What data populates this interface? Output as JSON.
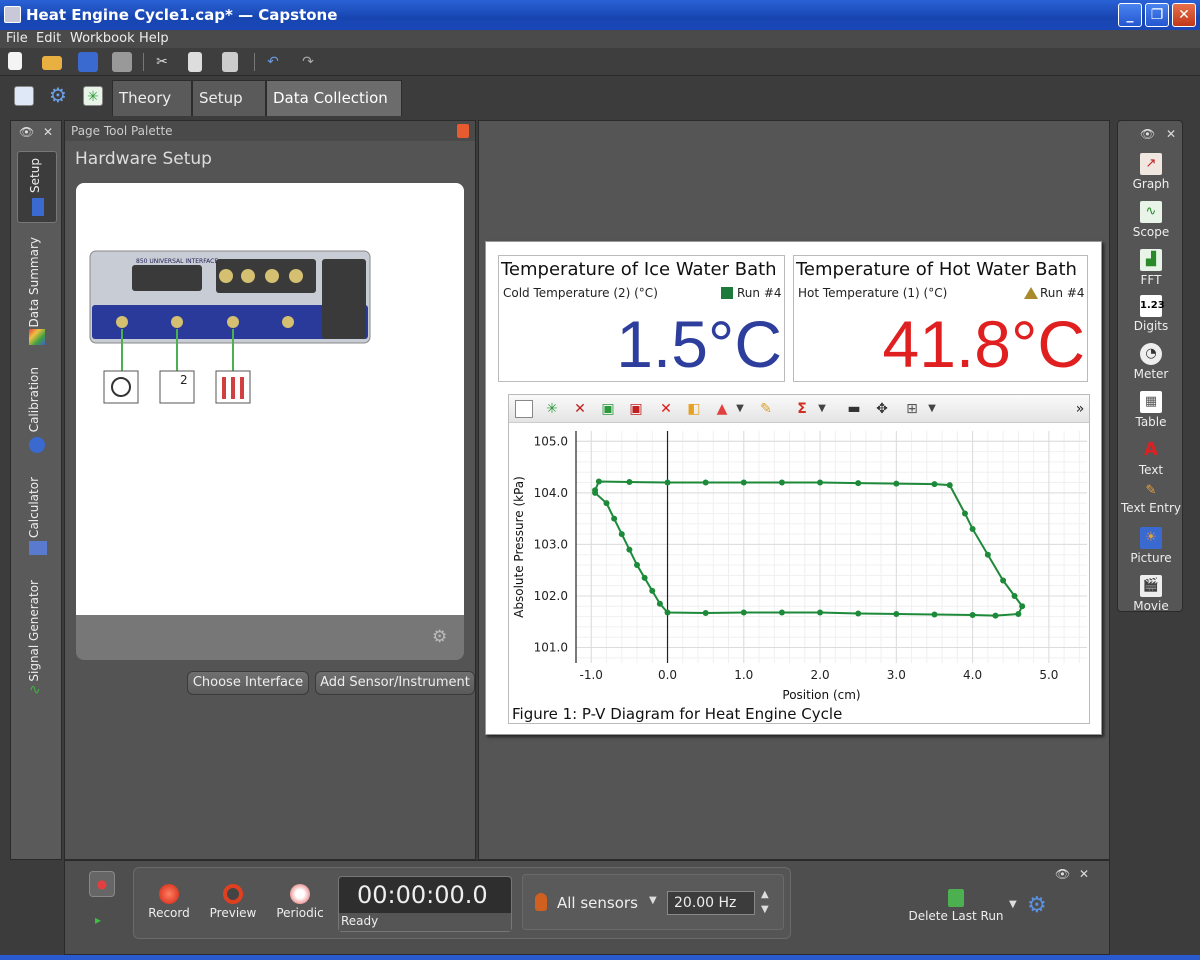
{
  "window": {
    "title": "Heat Engine Cycle1.cap* — Capstone"
  },
  "menu": [
    "File",
    "Edit",
    "Workbook",
    "Help"
  ],
  "tabs": [
    {
      "label": "Theory"
    },
    {
      "label": "Setup"
    },
    {
      "label": "Data Collection"
    }
  ],
  "left_rail": [
    "Setup",
    "Data Summary",
    "Calibration",
    "Calculator",
    "Signal Generator"
  ],
  "palette": {
    "header": "Page Tool Palette",
    "title": "Hardware Setup",
    "interface_brand": "850 UNIVERSAL INTERFACE",
    "sensor_label": "2"
  },
  "buttons": {
    "choose_interface": "Choose Interface",
    "add_sensor": "Add Sensor/Instrument"
  },
  "digits": [
    {
      "title": "Temperature of Ice Water Bath",
      "measurement": "Cold Temperature (2) (°C)",
      "run": "Run #4",
      "value": "1.5°C",
      "color": "#2e3e9c",
      "marker_color": "#1d7a3a"
    },
    {
      "title": "Temperature of Hot Water Bath",
      "measurement": "Hot Temperature (1) (°C)",
      "run": "Run #4",
      "value": "41.8°C",
      "color": "#e02020",
      "marker_color": "#a88a2a"
    }
  ],
  "chart_data": {
    "type": "scatter",
    "xlabel": "Position (cm)",
    "ylabel": "Absolute Pressure (kPa)",
    "xlim": [
      -1.2,
      5.5
    ],
    "ylim": [
      100.7,
      105.2
    ],
    "x_ticks": [
      "-1.0",
      "0.0",
      "1.0",
      "2.0",
      "3.0",
      "4.0",
      "5.0"
    ],
    "y_ticks": [
      "105.0",
      "104.0",
      "103.0",
      "102.0",
      "101.0"
    ],
    "grid": true,
    "series": [
      {
        "color": "#1d8a3a",
        "points": [
          [
            -0.95,
            104.05
          ],
          [
            -0.9,
            104.22
          ],
          [
            -0.5,
            104.21
          ],
          [
            0.0,
            104.2
          ],
          [
            0.5,
            104.2
          ],
          [
            1.0,
            104.2
          ],
          [
            1.5,
            104.2
          ],
          [
            2.0,
            104.2
          ],
          [
            2.5,
            104.19
          ],
          [
            3.0,
            104.18
          ],
          [
            3.5,
            104.17
          ],
          [
            3.7,
            104.15
          ],
          [
            3.9,
            103.6
          ],
          [
            4.0,
            103.3
          ],
          [
            4.2,
            102.8
          ],
          [
            4.4,
            102.3
          ],
          [
            4.55,
            102.0
          ],
          [
            4.65,
            101.8
          ],
          [
            4.6,
            101.65
          ],
          [
            4.3,
            101.62
          ],
          [
            4.0,
            101.63
          ],
          [
            3.5,
            101.64
          ],
          [
            3.0,
            101.65
          ],
          [
            2.5,
            101.66
          ],
          [
            2.0,
            101.68
          ],
          [
            1.5,
            101.68
          ],
          [
            1.0,
            101.68
          ],
          [
            0.5,
            101.67
          ],
          [
            0.0,
            101.68
          ],
          [
            -0.1,
            101.85
          ],
          [
            -0.2,
            102.1
          ],
          [
            -0.3,
            102.35
          ],
          [
            -0.4,
            102.6
          ],
          [
            -0.5,
            102.9
          ],
          [
            -0.6,
            103.2
          ],
          [
            -0.7,
            103.5
          ],
          [
            -0.8,
            103.8
          ],
          [
            -0.95,
            104.0
          ]
        ]
      }
    ]
  },
  "caption": "Figure 1: P-V Diagram for Heat Engine Cycle",
  "right_palette": [
    "Graph",
    "Scope",
    "FFT",
    "Digits",
    "Meter",
    "Table",
    "Text",
    "Text Entry",
    "Picture",
    "Movie"
  ],
  "digits_icon_text": "1.23",
  "controls": {
    "record": "Record",
    "preview": "Preview",
    "periodic": "Periodic",
    "timer": "00:00:00.0",
    "status": "Ready",
    "sensors": "All sensors",
    "rate": "20.00 Hz",
    "delete_last": "Delete Last Run"
  }
}
